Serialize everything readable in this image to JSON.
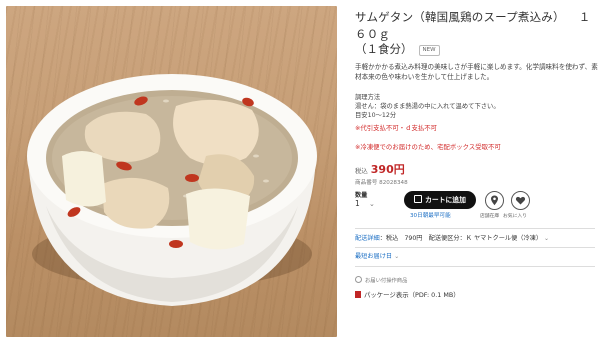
{
  "product": {
    "title_name": "サムゲタン（韓国風鶏のスープ煮込み）",
    "title_weight": "１６０ｇ",
    "title_line2": "（１食分）",
    "new_badge": "NEW",
    "description": "手軽かかかる煮込み料理の美味しさが手軽に楽しめます。化学調味料を使わず、素材本来の色や味わいを生かして仕上げました。",
    "cook_heading": "調理方法",
    "cook_method": "湯せん：袋のまま熱湯の中に入れて温めて下さい。",
    "cook_time": "目安10～12分",
    "notice_payment": "※代引支払不可・ｄ支払不可",
    "notice_frozen": "※冷凍便でのお届けのため、宅配ボックス受取不可",
    "price_label": "税込",
    "price": "390円",
    "code_label": "商品番号",
    "code": "82028348"
  },
  "purchase": {
    "qty_label": "数量",
    "qty_value": "1",
    "cart_button": "カートに追加",
    "earliest_delivery": "30日朝最早可能",
    "store_stock_label": "店舗在庫",
    "favorite_label": "お気に入り"
  },
  "shipping": {
    "detail_label": "配送詳細",
    "detail_value": "：税込　790円　配送便区分：Ｋ ヤマトクール便（冷凍）",
    "delivery_label": "最短お届け日"
  },
  "footer": {
    "no_return": "お届い付操作商品",
    "package": "パッケージ表示（PDF: 0.1 MB）"
  }
}
